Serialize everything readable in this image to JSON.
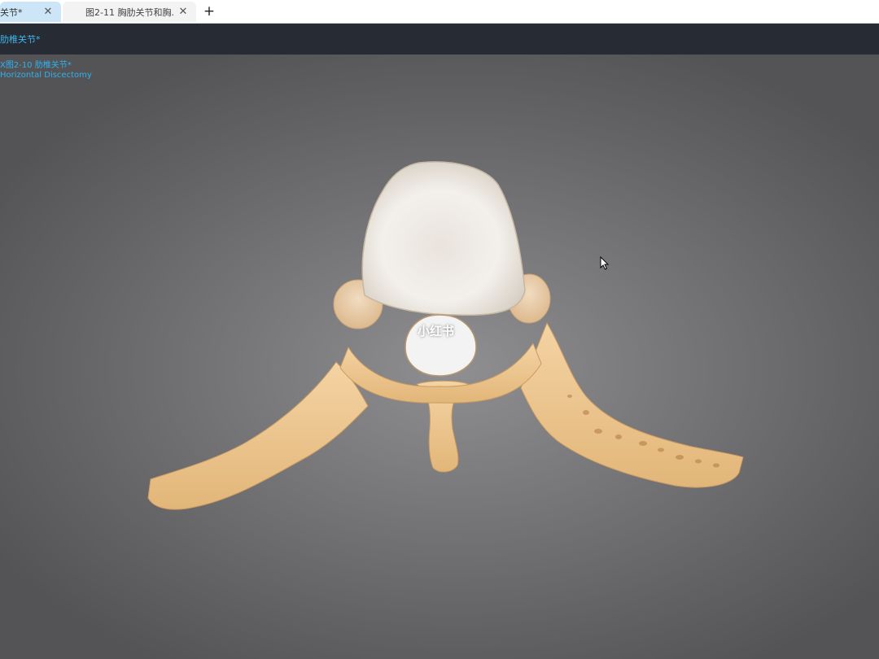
{
  "tabs": [
    {
      "label": "关节*",
      "active": true
    },
    {
      "label": "图2-11 胸肋关节和胸...",
      "active": false
    }
  ],
  "header": {
    "title": "肋椎关节*"
  },
  "viewport": {
    "model_title": "X图2-10 肋椎关节*",
    "model_subtitle": "Horizontal Discectomy",
    "watermark": "小红书"
  },
  "icons": {
    "close": "close-icon",
    "new_tab": "plus-icon",
    "cursor": "mouse-pointer-icon"
  },
  "colors": {
    "accent": "#3fb6ee",
    "header_bg": "#272b33",
    "active_tab": "#cde6f7",
    "bone": "#eac48f",
    "disc": "#ece8e2"
  }
}
